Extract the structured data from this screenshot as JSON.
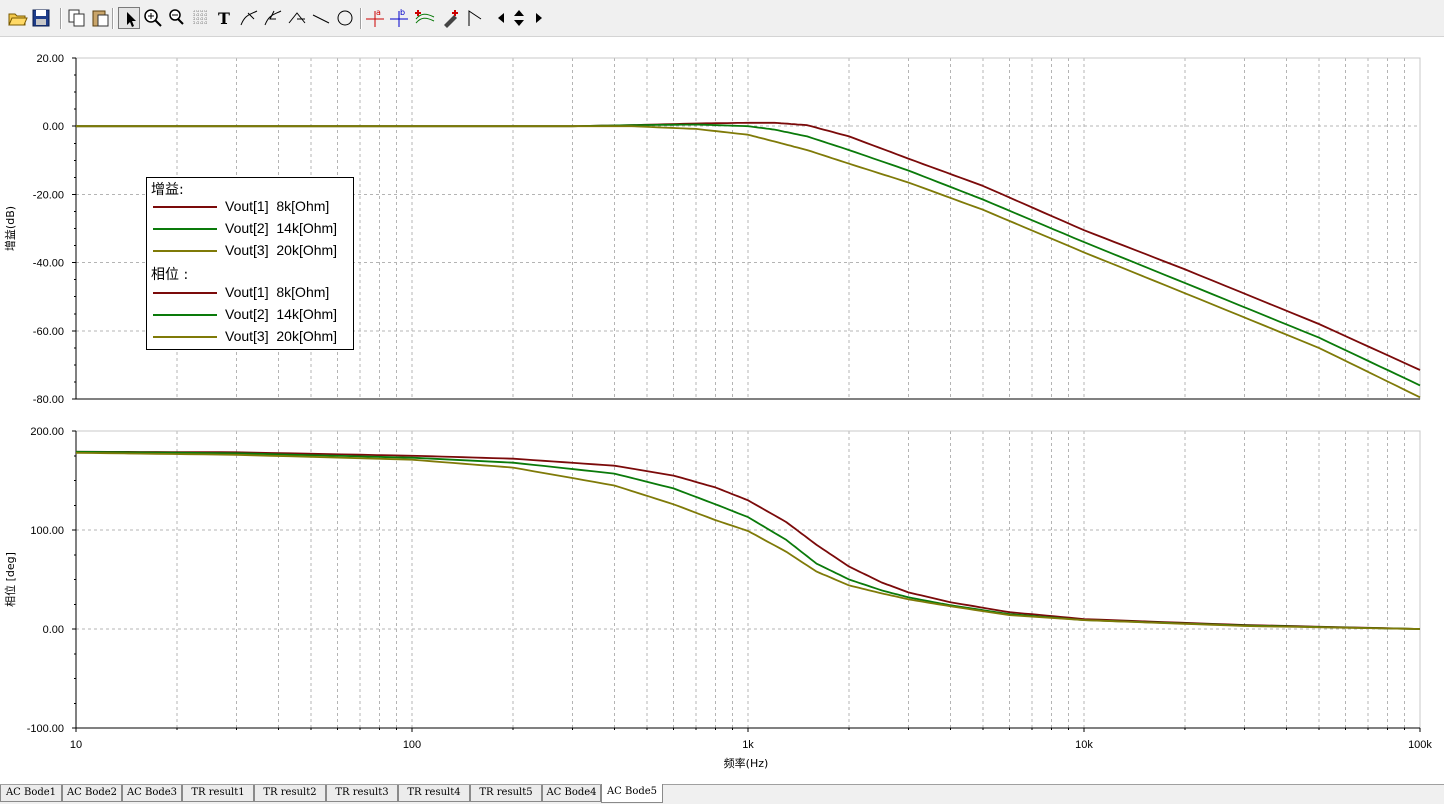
{
  "toolbar": {
    "buttons": [
      {
        "id": "open",
        "icon": "open-folder-icon"
      },
      {
        "id": "save",
        "icon": "save-disk-icon"
      },
      {
        "id": "copy",
        "icon": "copy-icon"
      },
      {
        "id": "paste",
        "icon": "paste-icon"
      },
      {
        "id": "select",
        "icon": "pointer-arrow-icon",
        "pressed": true
      },
      {
        "id": "zoom-in",
        "icon": "zoom-in-icon"
      },
      {
        "id": "zoom-100",
        "icon": "zoom-100-icon"
      },
      {
        "id": "grid",
        "icon": "grid-icon"
      },
      {
        "id": "text",
        "icon": "text-tool-icon"
      },
      {
        "id": "curve-label",
        "icon": "curve-label-icon"
      },
      {
        "id": "curve-label-2",
        "icon": "curve-label-alt-icon"
      },
      {
        "id": "bracket",
        "icon": "bracket-tool-icon"
      },
      {
        "id": "line",
        "icon": "line-tool-icon"
      },
      {
        "id": "circle",
        "icon": "circle-tool-icon"
      },
      {
        "id": "cursor-a",
        "icon": "cursor-a-icon"
      },
      {
        "id": "cursor-b",
        "icon": "cursor-b-icon"
      },
      {
        "id": "add-curve",
        "icon": "add-curve-icon"
      },
      {
        "id": "probe",
        "icon": "probe-icon"
      },
      {
        "id": "marker",
        "icon": "marker-flag-icon"
      },
      {
        "id": "prev",
        "icon": "arrow-left-icon"
      },
      {
        "id": "updown",
        "icon": "arrow-up-down-icon"
      },
      {
        "id": "next",
        "icon": "arrow-right-icon"
      }
    ]
  },
  "colors": {
    "series1": "#7b0a0a",
    "series2": "#0a7a0a",
    "series3": "#7f7a08",
    "grid": "#b4b4b4"
  },
  "chart_data": [
    {
      "type": "line",
      "ylabel": "增益(dB)",
      "xlabel": "",
      "x_scale": "log",
      "xlim": [
        10,
        100000
      ],
      "ylim": [
        -80,
        20
      ],
      "yticks": [
        20,
        0,
        -20,
        -40,
        -60,
        -80
      ],
      "ytick_labels": [
        "20.00",
        "0.00",
        "-20.00",
        "-40.00",
        "-60.00",
        "-80.00"
      ],
      "grid": true,
      "series": [
        {
          "name": "Vout[1]  8k[Ohm]",
          "color": "#7b0a0a",
          "x": [
            10,
            100,
            300,
            450,
            700,
            1000,
            1200,
            1500,
            2000,
            3000,
            5000,
            10000,
            20000,
            50000,
            100000
          ],
          "y": [
            0,
            0,
            0,
            0.3,
            0.8,
            1,
            1,
            0.3,
            -3,
            -9.5,
            -17.5,
            -30.5,
            -42,
            -58,
            -71.5
          ]
        },
        {
          "name": "Vout[2]  14k[Ohm]",
          "color": "#0a7a0a",
          "x": [
            10,
            100,
            300,
            450,
            700,
            1000,
            1200,
            1500,
            2000,
            3000,
            5000,
            10000,
            20000,
            50000,
            100000
          ],
          "y": [
            0,
            0,
            0,
            0.3,
            0.5,
            0,
            -1,
            -3,
            -7,
            -13,
            -21.5,
            -34,
            -46,
            -62,
            -76
          ]
        },
        {
          "name": "Vout[3]  20k[Ohm]",
          "color": "#7f7a08",
          "x": [
            10,
            100,
            300,
            450,
            700,
            1000,
            1200,
            1500,
            2000,
            3000,
            5000,
            10000,
            20000,
            50000,
            100000
          ],
          "y": [
            0,
            0,
            0,
            0,
            -0.8,
            -2.5,
            -4.5,
            -7,
            -11,
            -16.5,
            -24.5,
            -37,
            -49,
            -65,
            -79.5
          ]
        }
      ]
    },
    {
      "type": "line",
      "ylabel": "相位 [deg]",
      "xlabel": "频率(Hz)",
      "x_scale": "log",
      "xlim": [
        10,
        100000
      ],
      "ylim": [
        -100,
        200
      ],
      "xticks": [
        10,
        100,
        1000,
        10000,
        100000
      ],
      "xtick_labels": [
        "10",
        "100",
        "1k",
        "10k",
        "100k"
      ],
      "yticks": [
        200,
        100,
        0,
        -100
      ],
      "ytick_labels": [
        "200.00",
        "100.00",
        "0.00",
        "-100.00"
      ],
      "grid": true,
      "series": [
        {
          "name": "Vout[1]  8k[Ohm]",
          "color": "#7b0a0a",
          "x": [
            10,
            30,
            100,
            200,
            400,
            600,
            800,
            1000,
            1300,
            1600,
            2000,
            2500,
            3000,
            4000,
            6000,
            10000,
            30000,
            100000
          ],
          "y": [
            179,
            178.5,
            175,
            172,
            165,
            155,
            143,
            130,
            108,
            85,
            63,
            47,
            37,
            27,
            17,
            10,
            4,
            0
          ]
        },
        {
          "name": "Vout[2]  14k[Ohm]",
          "color": "#0a7a0a",
          "x": [
            10,
            30,
            100,
            200,
            400,
            600,
            800,
            1000,
            1300,
            1600,
            2000,
            2500,
            3000,
            4000,
            6000,
            10000,
            30000,
            100000
          ],
          "y": [
            179,
            177.5,
            173,
            168,
            157,
            142,
            126,
            113,
            90,
            66,
            50,
            39,
            32,
            24,
            15,
            9,
            3.5,
            0
          ]
        },
        {
          "name": "Vout[3]  20k[Ohm]",
          "color": "#7f7a08",
          "x": [
            10,
            30,
            100,
            200,
            400,
            600,
            800,
            1000,
            1300,
            1600,
            2000,
            2500,
            3000,
            4000,
            6000,
            10000,
            30000,
            100000
          ],
          "y": [
            178,
            176,
            171,
            163,
            145,
            126,
            110,
            99,
            78,
            58,
            44,
            36,
            30,
            23,
            14,
            9,
            3,
            0
          ]
        }
      ]
    }
  ],
  "legend": {
    "gain_header": "增益:",
    "phase_header": "相位 :",
    "entries": [
      "Vout[1]  8k[Ohm]",
      "Vout[2]  14k[Ohm]",
      "Vout[3]  20k[Ohm]"
    ]
  },
  "tabs": [
    {
      "label": "AC Bode1",
      "active": false
    },
    {
      "label": "AC Bode2",
      "active": false
    },
    {
      "label": "AC Bode3",
      "active": false
    },
    {
      "label": "TR result1",
      "active": false
    },
    {
      "label": "TR result2",
      "active": false
    },
    {
      "label": "TR result3",
      "active": false
    },
    {
      "label": "TR result4",
      "active": false
    },
    {
      "label": "TR result5",
      "active": false
    },
    {
      "label": "AC Bode4",
      "active": false
    },
    {
      "label": "AC Bode5",
      "active": true
    }
  ]
}
